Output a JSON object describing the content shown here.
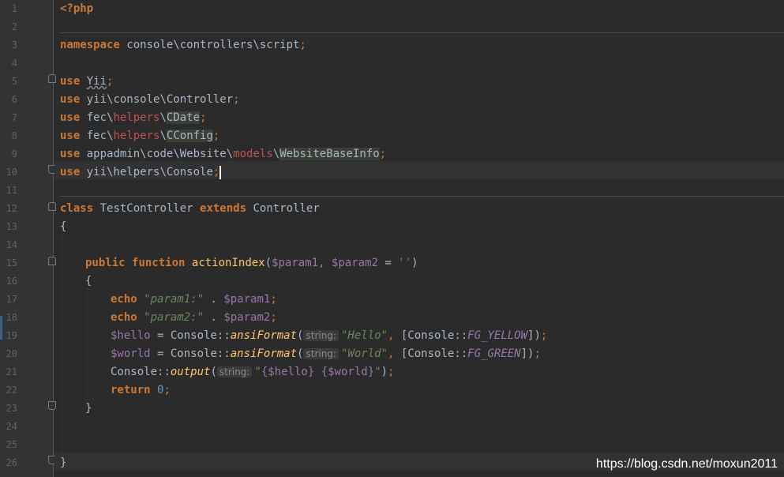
{
  "editor": {
    "line_numbers": [
      "1",
      "2",
      "3",
      "4",
      "5",
      "6",
      "7",
      "8",
      "9",
      "10",
      "11",
      "12",
      "13",
      "14",
      "15",
      "16",
      "17",
      "18",
      "19",
      "20",
      "21",
      "22",
      "23",
      "24",
      "25",
      "26"
    ],
    "current_line": 10,
    "tokens": {
      "l1": "<?php",
      "l3_kw": "namespace",
      "l3_ns": " console\\controllers\\script",
      "l3_semi": ";",
      "use": "use",
      "l5_cls": "Yii",
      "l6_ns": " yii\\console\\Controller",
      "l7_a": " fec\\",
      "l7_b": "helpers",
      "l7_c": "\\",
      "l7_d": "CDate",
      "l8_d": "CConfig",
      "l9_a": " appadmin\\code\\Website\\",
      "l9_b": "models",
      "l9_c": "\\",
      "l9_d": "WebsiteBaseInfo",
      "l10_ns": " yii\\helpers\\Console",
      "semi": ";",
      "l12_class": "class",
      "l12_name": " TestController ",
      "l12_extends": "extends",
      "l12_parent": " Controller",
      "brace_open": "{",
      "brace_close": "}",
      "l15_public": "public",
      "l15_function": "function",
      "l15_fname": "actionIndex",
      "l15_p1": "$param1",
      "l15_p2": "$param2",
      "l15_default": "''",
      "echo": "echo",
      "l17_str": "\"param1:\"",
      "l18_str": "\"param2:\"",
      "l19_var": "$hello",
      "l20_var": "$world",
      "console": "Console",
      "ansi": "ansiFormat",
      "hint_string": "string:",
      "l19_str": "\"Hello\"",
      "l19_const": "FG_YELLOW",
      "l20_str": "\"World\"",
      "l20_const": "FG_GREEN",
      "l21_method": "output",
      "l21_q1": "\"",
      "l21_v1": "{$hello}",
      "l21_v2": "{$world}",
      "l21_q2": "\"",
      "return": "return",
      "zero": "0"
    }
  },
  "watermark": "https://blog.csdn.net/moxun2011",
  "colors": {
    "background": "#2b2b2b",
    "gutter": "#313335",
    "keyword": "#cc7832",
    "string": "#6a8759",
    "variable": "#9876aa",
    "function": "#ffc66d",
    "number": "#6897bb",
    "text": "#a9b7c6"
  }
}
